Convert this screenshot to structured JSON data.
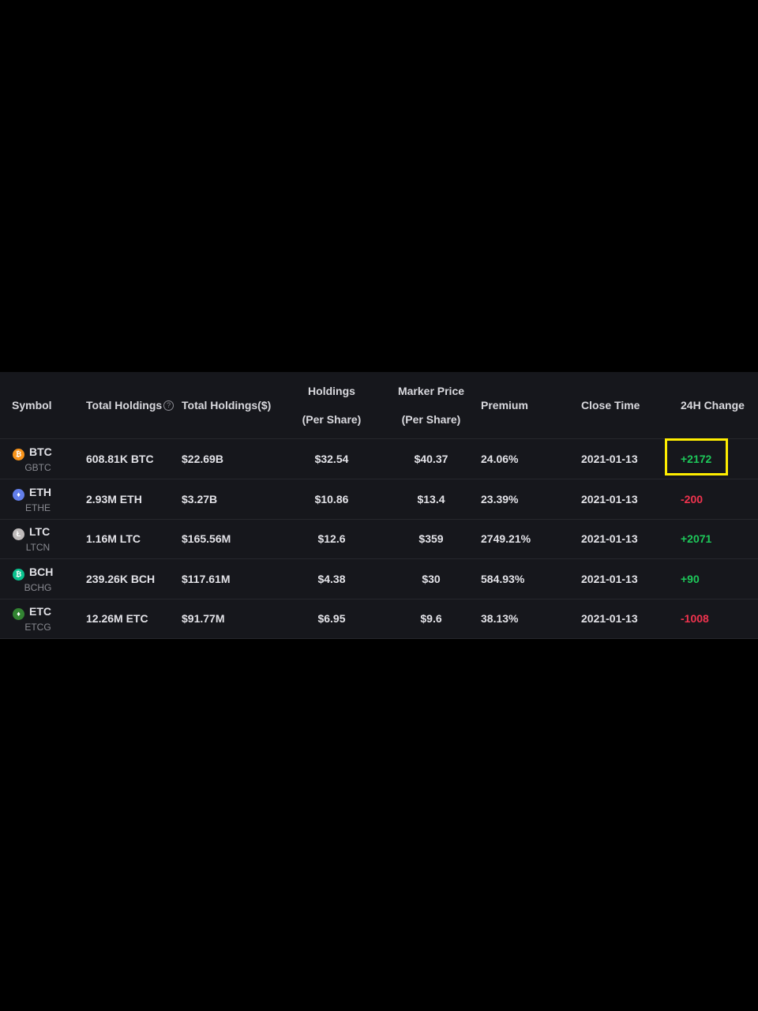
{
  "columns": {
    "symbol": "Symbol",
    "total_holdings": "Total Holdings",
    "total_holdings_usd": "Total Holdings($)",
    "holdings_per_share_l1": "Holdings",
    "holdings_per_share_l2": "(Per Share)",
    "market_price_l1": "Marker Price",
    "market_price_l2": "(Per Share)",
    "premium": "Premium",
    "close_time": "Close Time",
    "change_24h": "24H Change"
  },
  "rows": [
    {
      "coin": "BTC",
      "fund": "GBTC",
      "icon": "bitcoin-icon",
      "icon_glyph": "₿",
      "icon_color": "#f7931a",
      "total_holdings": "608.81K BTC",
      "total_holdings_usd": "$22.69B",
      "holdings_per_share": "$32.54",
      "market_price": "$40.37",
      "premium": "24.06%",
      "close_time": "2021-01-13",
      "change_24h": "+2172",
      "change_dir": "pos"
    },
    {
      "coin": "ETH",
      "fund": "ETHE",
      "icon": "ethereum-icon",
      "icon_glyph": "♦",
      "icon_color": "#627eea",
      "total_holdings": "2.93M ETH",
      "total_holdings_usd": "$3.27B",
      "holdings_per_share": "$10.86",
      "market_price": "$13.4",
      "premium": "23.39%",
      "close_time": "2021-01-13",
      "change_24h": "-200",
      "change_dir": "neg"
    },
    {
      "coin": "LTC",
      "fund": "LTCN",
      "icon": "litecoin-icon",
      "icon_glyph": "Ł",
      "icon_color": "#bfbbbb",
      "total_holdings": "1.16M LTC",
      "total_holdings_usd": "$165.56M",
      "holdings_per_share": "$12.6",
      "market_price": "$359",
      "premium": "2749.21%",
      "close_time": "2021-01-13",
      "change_24h": "+2071",
      "change_dir": "pos"
    },
    {
      "coin": "BCH",
      "fund": "BCHG",
      "icon": "bitcoin-cash-icon",
      "icon_glyph": "₿",
      "icon_color": "#0ac18e",
      "total_holdings": "239.26K BCH",
      "total_holdings_usd": "$117.61M",
      "holdings_per_share": "$4.38",
      "market_price": "$30",
      "premium": "584.93%",
      "close_time": "2021-01-13",
      "change_24h": "+90",
      "change_dir": "pos"
    },
    {
      "coin": "ETC",
      "fund": "ETCG",
      "icon": "ethereum-classic-icon",
      "icon_glyph": "♦",
      "icon_color": "#328332",
      "total_holdings": "12.26M ETC",
      "total_holdings_usd": "$91.77M",
      "holdings_per_share": "$6.95",
      "market_price": "$9.6",
      "premium": "38.13%",
      "close_time": "2021-01-13",
      "change_24h": "-1008",
      "change_dir": "neg"
    }
  ],
  "colors": {
    "background": "#000000",
    "table_background": "#16171c",
    "positive": "#1ec85a",
    "negative": "#f0334e",
    "highlight": "#ffee00"
  }
}
